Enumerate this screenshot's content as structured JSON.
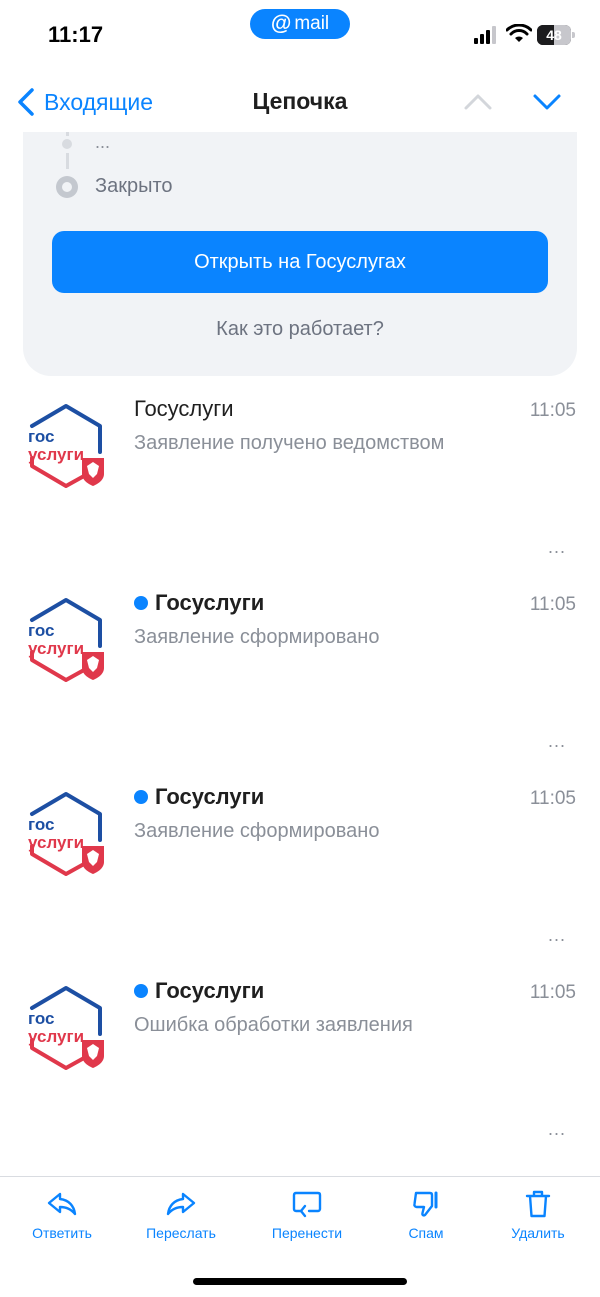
{
  "status_bar": {
    "time": "11:17",
    "app_pill": "mail",
    "battery_level": "48"
  },
  "nav": {
    "back_label": "Входящие",
    "title": "Цепочка"
  },
  "status_card": {
    "ellipsis_step": "...",
    "closed_label": "Закрыто",
    "open_button": "Открыть на Госуслугах",
    "how_link": "Как это работает?"
  },
  "messages": [
    {
      "sender": "Госуслуги",
      "subject": "Заявление получено ведомством",
      "time": "11:05",
      "unread": false
    },
    {
      "sender": "Госуслуги",
      "subject": "Заявление сформировано",
      "time": "11:05",
      "unread": true
    },
    {
      "sender": "Госуслуги",
      "subject": "Заявление сформировано",
      "time": "11:05",
      "unread": true
    },
    {
      "sender": "Госуслуги",
      "subject": "Ошибка обработки заявления",
      "time": "11:05",
      "unread": true
    }
  ],
  "more_glyph": "...",
  "logo": {
    "line1": "гос",
    "line2": "услуги"
  },
  "toolbar": {
    "reply": "Ответить",
    "forward": "Переслать",
    "move": "Перенести",
    "spam": "Спам",
    "delete": "Удалить"
  },
  "colors": {
    "accent": "#0a84ff",
    "logo_blue": "#1d4fa3",
    "logo_red": "#e0384b",
    "card_bg": "#f1f3f6"
  }
}
